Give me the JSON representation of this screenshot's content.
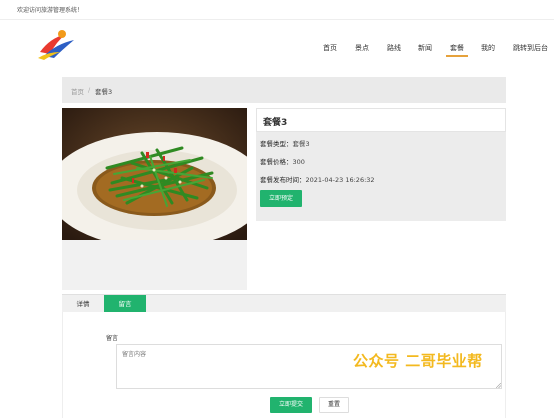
{
  "topbar": {
    "welcome": "欢迎访问旅游管理系统！"
  },
  "nav": {
    "items": [
      {
        "label": "首页",
        "active": false
      },
      {
        "label": "景点",
        "active": false
      },
      {
        "label": "路线",
        "active": false
      },
      {
        "label": "新闻",
        "active": false
      },
      {
        "label": "套餐",
        "active": true
      },
      {
        "label": "我的",
        "active": false
      },
      {
        "label": "跳转到后台",
        "active": false
      }
    ],
    "active_color": "#e6a23c"
  },
  "breadcrumb": {
    "home": "首页",
    "separator": "/",
    "current": "套餐3"
  },
  "package": {
    "title": "套餐3",
    "type_label": "套餐类型：",
    "type_value": "套餐3",
    "price_label": "套餐价格：",
    "price_value": "300",
    "time_label": "套餐发布时间：",
    "time_value": "2021-04-23 16:26:32",
    "reserve_button": "立即预定"
  },
  "tabs": {
    "detail": "详情",
    "comment": "留言",
    "active": "comment"
  },
  "comment_form": {
    "label": "留言",
    "placeholder": "留言内容",
    "submit": "立即提交",
    "reset": "重置"
  },
  "watermark": "公众号  二哥毕业帮",
  "colors": {
    "primary_green": "#21b36e",
    "accent": "#e6a23c",
    "watermark": "#f3b91f"
  }
}
